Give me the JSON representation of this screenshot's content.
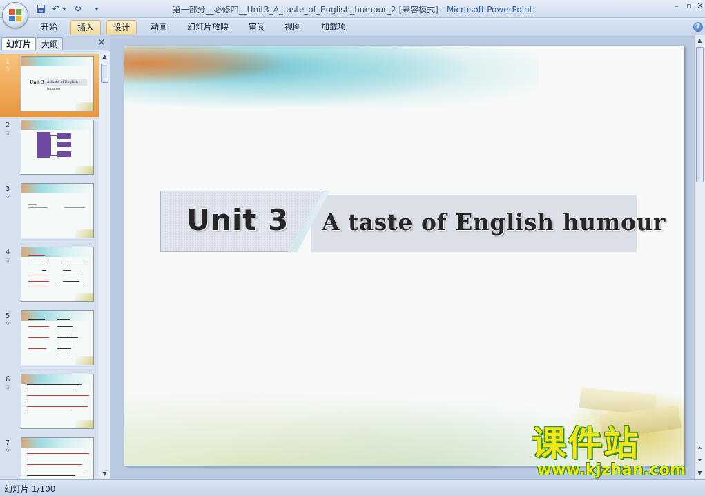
{
  "window": {
    "title_doc": "第一部分__必修四__Unit3_A_taste_of_English_humour_2 [兼容模式]",
    "title_sep": " - ",
    "title_app": "Microsoft PowerPoint"
  },
  "ribbon": {
    "tabs": [
      {
        "label": "开始",
        "active": false
      },
      {
        "label": "插入",
        "active": true
      },
      {
        "label": "设计",
        "active": true
      },
      {
        "label": "动画",
        "active": false
      },
      {
        "label": "幻灯片放映",
        "active": false
      },
      {
        "label": "审阅",
        "active": false
      },
      {
        "label": "视图",
        "active": false
      },
      {
        "label": "加载项",
        "active": false
      }
    ]
  },
  "panel": {
    "tab_slides": "幻灯片",
    "tab_outline": "大纲",
    "slides": [
      {
        "num": "1",
        "selected": true
      },
      {
        "num": "2",
        "selected": false
      },
      {
        "num": "3",
        "selected": false
      },
      {
        "num": "4",
        "selected": false
      },
      {
        "num": "5",
        "selected": false
      },
      {
        "num": "6",
        "selected": false
      },
      {
        "num": "7",
        "selected": false
      }
    ],
    "thumb1": {
      "unit": "Unit 3",
      "title": "A taste of English humour"
    }
  },
  "slide": {
    "unit": "Unit 3",
    "title": "A taste of English humour"
  },
  "status": {
    "slide_counter": "幻灯片 1/100"
  },
  "watermark": {
    "cn": "课件站",
    "url": "www.kjzhan.com"
  },
  "colors": {
    "selected_thumb": "#e8953c",
    "active_tab": "#f2d99a",
    "watermark_fill": "#f2e51a",
    "watermark_outline": "#2d8a1e"
  },
  "icons": [
    "office-button-icon",
    "save-icon",
    "undo-icon",
    "redo-icon",
    "customize-icon",
    "minimize-icon",
    "restore-icon",
    "close-icon",
    "help-icon",
    "star-icon"
  ]
}
